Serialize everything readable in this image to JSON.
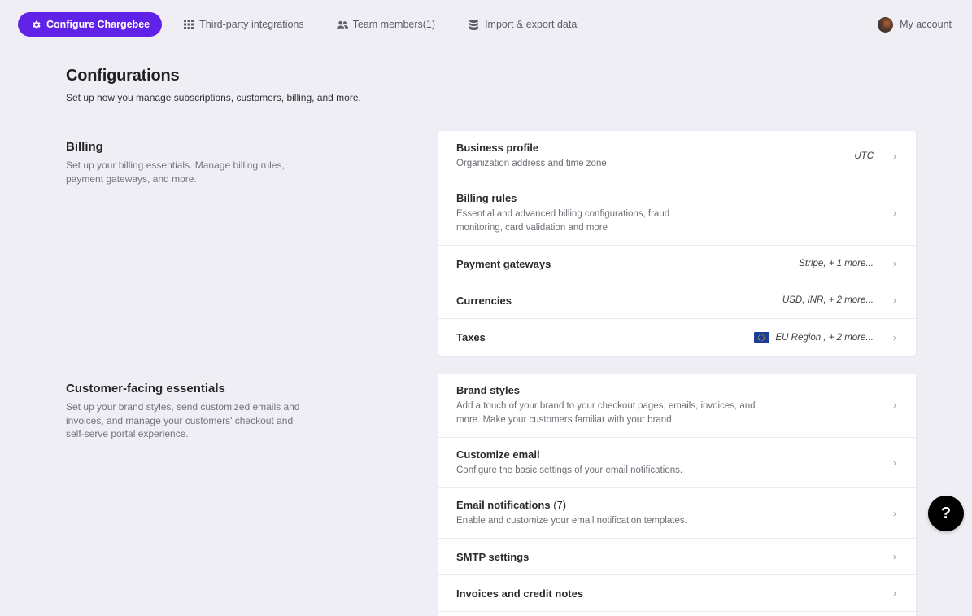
{
  "nav": {
    "configure": "Configure Chargebee",
    "integrations": "Third-party integrations",
    "team": "Team members(1)",
    "import_export": "Import & export data",
    "account": "My account"
  },
  "header": {
    "title": "Configurations",
    "subtitle": "Set up how you manage subscriptions, customers, billing, and more."
  },
  "sections": [
    {
      "title": "Billing",
      "description": "Set up your billing essentials. Manage billing rules, payment gateways, and more.",
      "items": [
        {
          "title": "Business profile",
          "description": "Organization address and time zone",
          "value": "UTC"
        },
        {
          "title": "Billing rules",
          "description": "Essential and advanced billing configurations, fraud monitoring, card validation and more",
          "value": ""
        },
        {
          "title": "Payment gateways",
          "description": "",
          "value": "Stripe, + 1 more..."
        },
        {
          "title": "Currencies",
          "description": "",
          "value": "USD, INR, + 2 more..."
        },
        {
          "title": "Taxes",
          "description": "",
          "value": "EU Region , + 2 more...",
          "icon": "eu-flag-icon"
        }
      ]
    },
    {
      "title": "Customer-facing essentials",
      "description": "Set up your brand styles, send customized emails and invoices, and manage your customers' checkout and self-serve portal experience.",
      "items": [
        {
          "title": "Brand styles",
          "description": "Add a touch of your brand to your checkout pages, emails, invoices, and more. Make your customers familiar with your brand.",
          "value": ""
        },
        {
          "title": "Customize email",
          "description": "Configure the basic settings of your email notifications.",
          "value": ""
        },
        {
          "title": "Email notifications",
          "count": "(7)",
          "description": "Enable and customize your email notification templates.",
          "value": ""
        },
        {
          "title": "SMTP settings",
          "description": "",
          "value": ""
        },
        {
          "title": "Invoices and credit notes",
          "description": "",
          "value": ""
        }
      ]
    }
  ],
  "help": {
    "label": "?"
  },
  "colors": {
    "accent": "#5f22e6",
    "background": "#efeef5"
  }
}
